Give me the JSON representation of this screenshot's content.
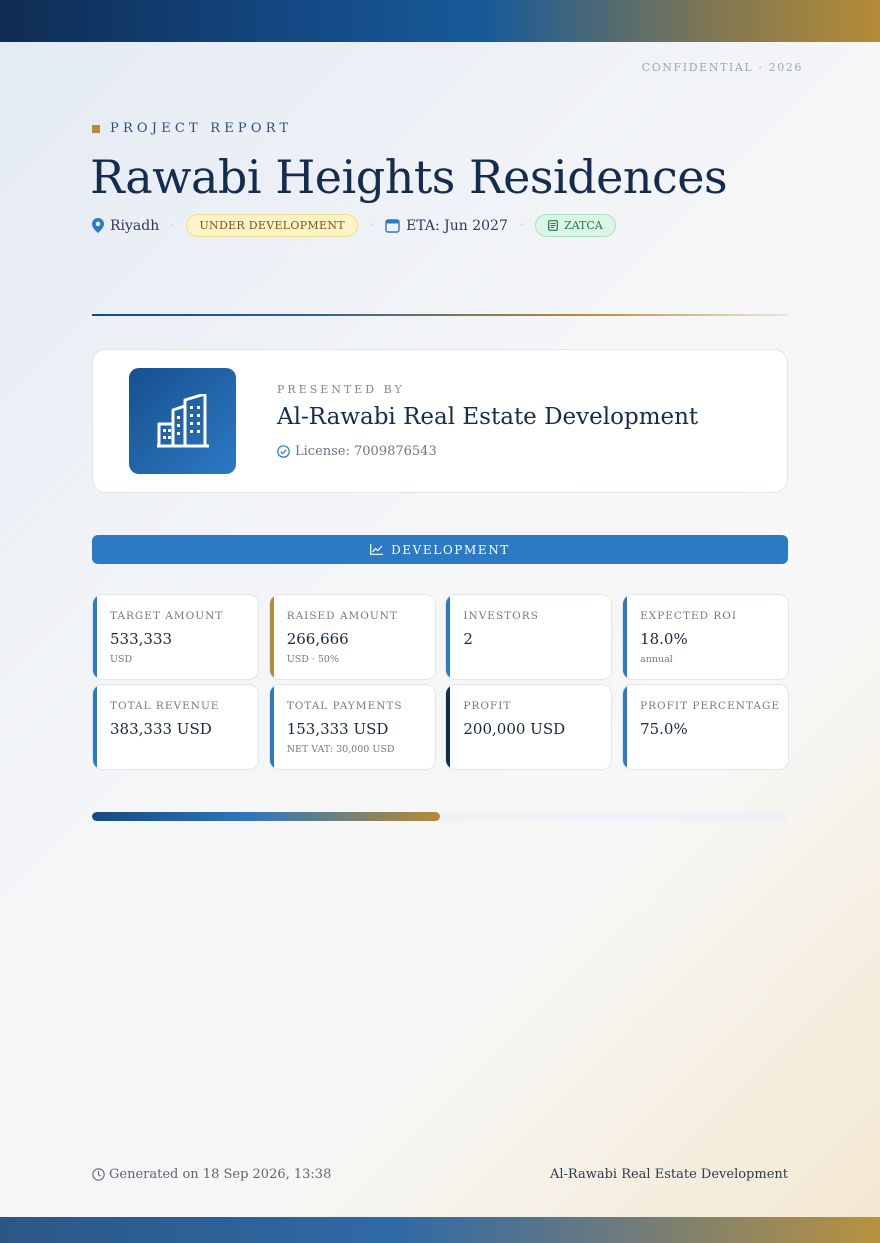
{
  "confidential": "CONFIDENTIAL · 2026",
  "report": {
    "eyebrow": "PROJECT REPORT",
    "title": "Rawabi Heights Residences",
    "location": "Riyadh",
    "status_badge": "UNDER DEVELOPMENT",
    "eta": "ETA: Jun 2027",
    "compliance_badge": "ZATCA",
    "separator": "·"
  },
  "presenter": {
    "label": "PRESENTED BY",
    "company": "Al-Rawabi Real Estate Development",
    "license": "License: 7009876543",
    "logo_icon": "building-icon"
  },
  "section": {
    "label": "DEVELOPMENT",
    "icon": "chart-line-icon"
  },
  "metrics": [
    {
      "label": "TARGET AMOUNT",
      "value": "533,333",
      "sub": "USD",
      "accent": "#2c7ac4"
    },
    {
      "label": "RAISED AMOUNT",
      "value": "266,666",
      "sub": "USD · 50%",
      "accent": "#b58b35"
    },
    {
      "label": "INVESTORS",
      "value": "2",
      "sub": "",
      "accent": "#2c7ac4"
    },
    {
      "label": "EXPECTED ROI",
      "value": "18.0%",
      "sub": "annual",
      "accent": "#2c7ac4"
    },
    {
      "label": "TOTAL REVENUE",
      "value": "383,333 USD",
      "sub": "",
      "accent": "#2c7ac4"
    },
    {
      "label": "TOTAL PAYMENTS",
      "value": "153,333 USD",
      "sub": "NET VAT: 30,000 USD",
      "accent": "#2c7ac4"
    },
    {
      "label": "PROFIT",
      "value": "200,000 USD",
      "sub": "",
      "accent": "#142c4d"
    },
    {
      "label": "PROFIT PERCENTAGE",
      "value": "75.0%",
      "sub": "",
      "accent": "#2c7ac4"
    }
  ],
  "funding_progress": 0.5,
  "footer": {
    "generated": "Generated on 18 Sep 2026, 13:38",
    "company": "Al-Rawabi Real Estate Development"
  },
  "colors": {
    "primary": "#2c7ac4",
    "navy": "#142c4d",
    "gold": "#b58b35"
  }
}
